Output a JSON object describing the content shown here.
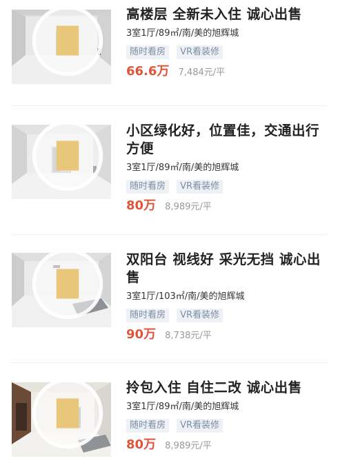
{
  "listings": [
    {
      "title": "高楼层 全新未入住 诚心出售",
      "meta": "3室1厅/89㎡/南/美的旭辉城",
      "tags": [
        "随时看房",
        "VR看装修"
      ],
      "price": "66.6万",
      "unit_price": "7,484元/平",
      "image_icon": "vr-360-badge-icon"
    },
    {
      "title": "小区绿化好，位置佳，交通出行方便",
      "meta": "3室1厅/89㎡/南/美的旭辉城",
      "tags": [
        "随时看房",
        "VR看装修"
      ],
      "price": "80万",
      "unit_price": "8,989元/平",
      "image_icon": "vr-360-badge-icon"
    },
    {
      "title": "双阳台 视线好 采光无挡 诚心出售",
      "meta": "3室1厅/103㎡/南/美的旭辉城",
      "tags": [
        "随时看房",
        "VR看装修"
      ],
      "price": "90万",
      "unit_price": "8,738元/平",
      "image_icon": "vr-360-badge-icon"
    },
    {
      "title": "拎包入住 自住二改 诚心出售",
      "meta": "3室1厅/89㎡/南/美的旭辉城",
      "tags": [
        "随时看房",
        "VR看装修"
      ],
      "price": "80万",
      "unit_price": "8,989元/平",
      "image_icon": "vr-360-badge-icon"
    }
  ],
  "colors": {
    "price": "#e0553a",
    "tag_text": "#7d8da3",
    "tag_bg": "#eef2f6",
    "divider": "#eeeeee"
  }
}
